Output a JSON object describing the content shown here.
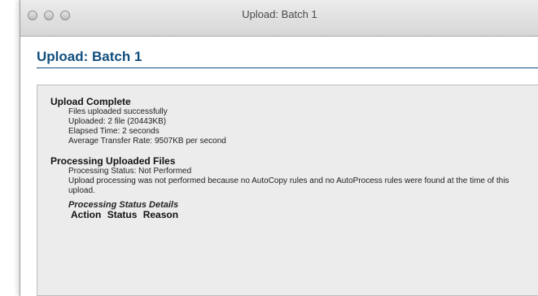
{
  "window": {
    "title": "Upload: Batch 1"
  },
  "page": {
    "title": "Upload: Batch 1"
  },
  "upload": {
    "heading": "Upload Complete",
    "lines": [
      "Files uploaded successfully",
      "Uploaded: 2 file (20443KB)",
      "Elapsed Time: 2 seconds",
      "Average Transfer Rate: 9507KB per second"
    ]
  },
  "processing": {
    "heading": "Processing Uploaded Files",
    "status": "Processing Status: Not Performed",
    "message": "Upload processing was not performed because no AutoCopy rules and no AutoProcess rules were found at the time of this upload.",
    "details_title": "Processing Status Details",
    "columns": [
      "Action",
      "Status",
      "Reason"
    ]
  }
}
